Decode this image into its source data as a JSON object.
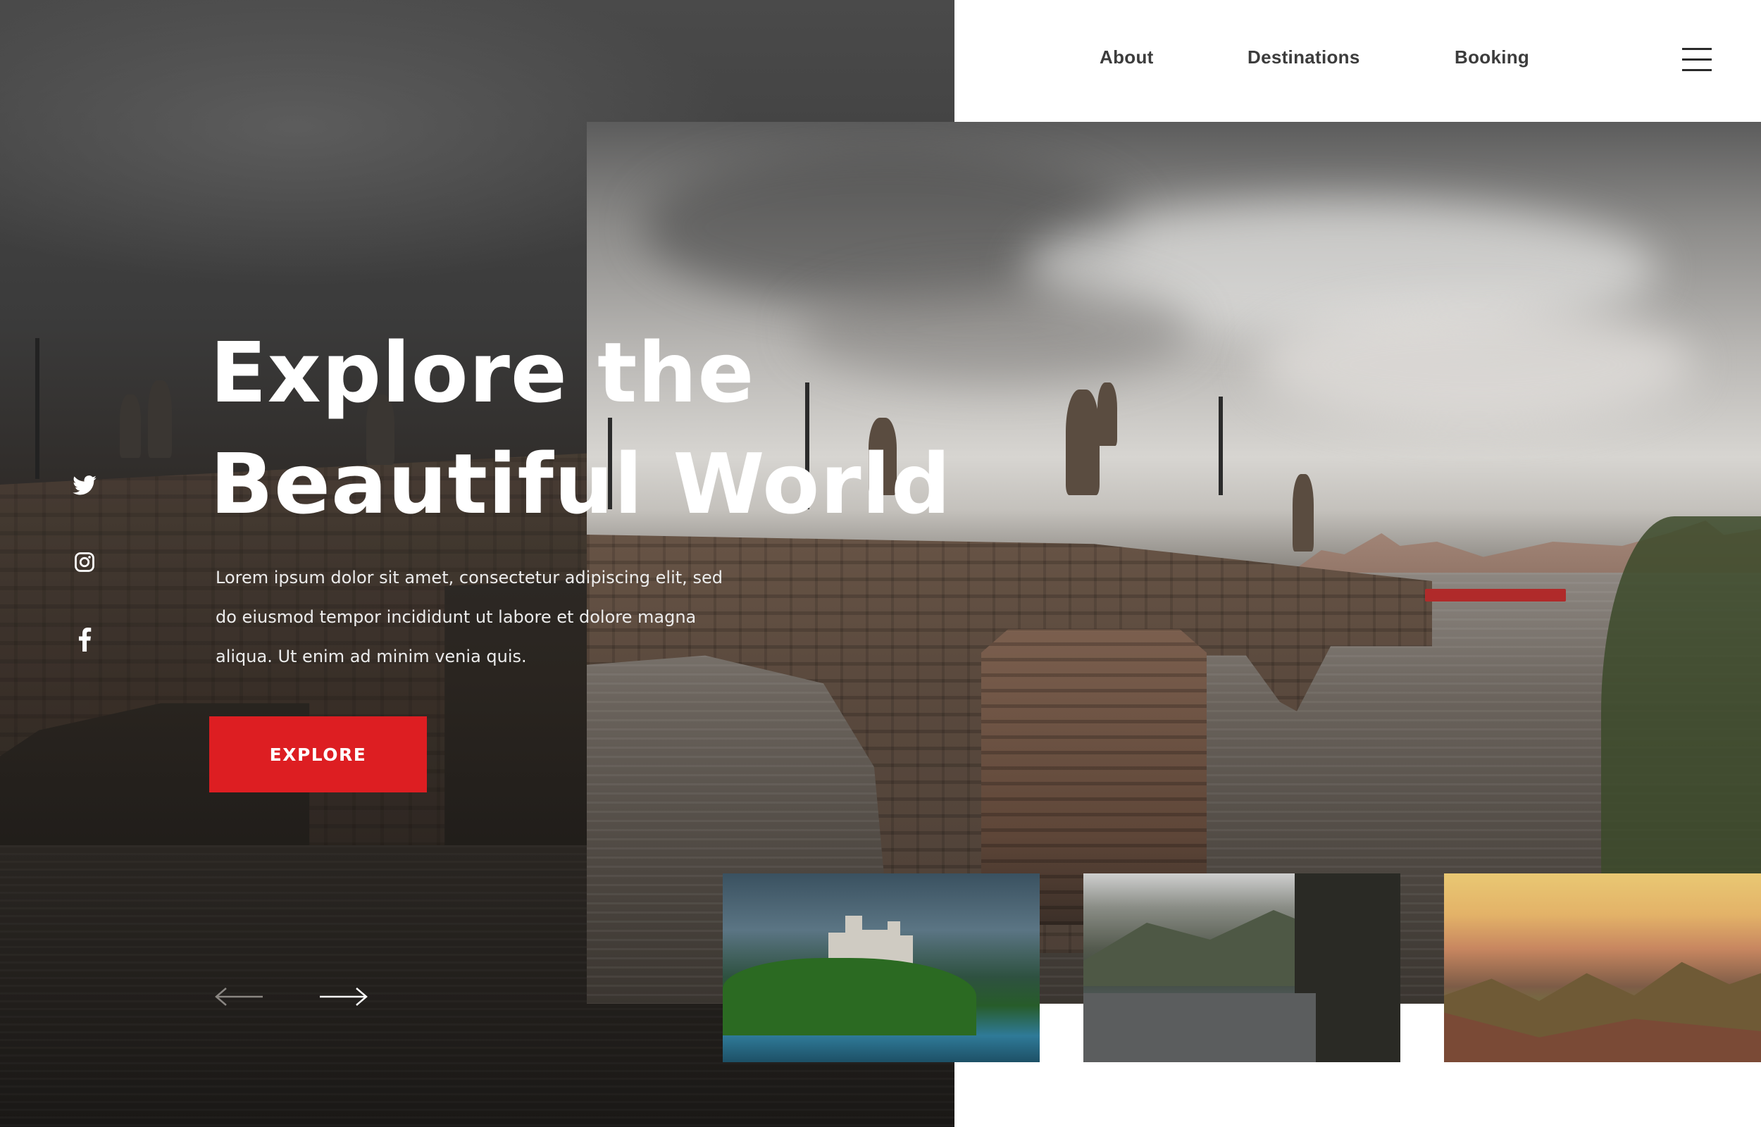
{
  "nav": {
    "items": [
      {
        "label": "About"
      },
      {
        "label": "Destinations"
      },
      {
        "label": "Booking"
      }
    ],
    "menu_icon": "hamburger-menu-icon"
  },
  "hero": {
    "headline_line1": "Explore the",
    "headline_line2": "Beautiful World",
    "lead_line1": "Lorem ipsum dolor sit amet, consectetur adipiscing elit, sed",
    "lead_line2": "do eiusmod tempor incididunt ut labore et dolore magna",
    "lead_line3": "aliqua. Ut enim ad minim venia quis.",
    "cta_label": "EXPLORE",
    "hero_image": "charles-bridge-photo"
  },
  "social": [
    {
      "icon": "twitter-icon"
    },
    {
      "icon": "instagram-icon"
    },
    {
      "icon": "facebook-icon"
    }
  ],
  "slider": {
    "prev_icon": "arrow-left-icon",
    "next_icon": "arrow-right-icon"
  },
  "thumbnails": [
    {
      "subject": "castle-on-lake"
    },
    {
      "subject": "mountain-river-valley"
    },
    {
      "subject": "golden-mountain-range"
    }
  ],
  "colors": {
    "accent": "#dd1e22",
    "nav_text": "#3c3c3c",
    "dark_panel": "#2a2622",
    "background": "#ffffff"
  }
}
